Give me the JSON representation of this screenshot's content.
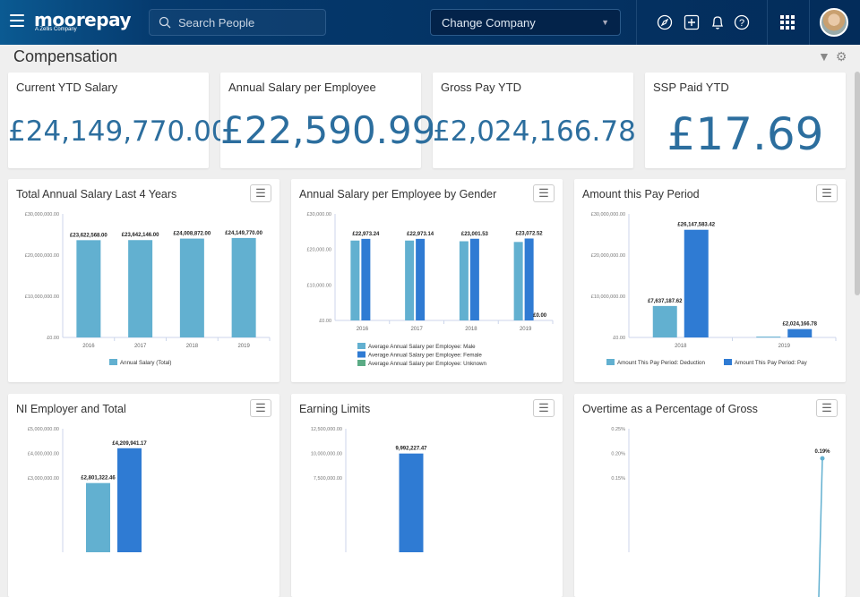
{
  "header": {
    "logo": "moorepay",
    "logo_sub": "A Zellis Company",
    "search_placeholder": "Search People",
    "company_select": "Change Company",
    "icons": [
      "menu-icon",
      "search-icon",
      "compass-icon",
      "add-icon",
      "bell-icon",
      "help-icon",
      "apps-grid-icon",
      "avatar"
    ]
  },
  "page": {
    "title": "Compensation"
  },
  "kpis": [
    {
      "label": "Current YTD Salary",
      "value": "£24,149,770.00"
    },
    {
      "label": "Annual Salary per Employee",
      "value": "£22,590.99"
    },
    {
      "label": "Gross Pay YTD",
      "value": "£2,024,166.78"
    },
    {
      "label": "SSP Paid YTD",
      "value": "£17.69"
    }
  ],
  "colors": {
    "light": "#62b0d0",
    "dark": "#2f7bd3",
    "green": "#5bab85",
    "kpi": "#2c6e9e"
  },
  "chart_data": [
    {
      "type": "bar",
      "title": "Total Annual Salary Last 4 Years",
      "ylim": [
        0,
        30000000
      ],
      "yticks": [
        "£0.00",
        "£10,000,000.00",
        "£20,000,000.00",
        "£30,000,000.00"
      ],
      "ytick_values": [
        0,
        10000000,
        20000000,
        30000000
      ],
      "categories": [
        "2016",
        "2017",
        "2018",
        "2019"
      ],
      "series": [
        {
          "name": "Annual Salary (Total)",
          "color": "#62b0d0",
          "values": [
            23622568,
            23642146,
            24008872,
            24149770
          ],
          "labels": [
            "£23,622,568.00",
            "£23,642,146.00",
            "£24,008,872.00",
            "£24,149,770.00"
          ]
        }
      ]
    },
    {
      "type": "bar",
      "title": "Annual Salary per Employee by Gender",
      "ylim": [
        0,
        30000
      ],
      "yticks": [
        "£0.00",
        "£10,000.00",
        "£20,000.00",
        "£30,000.00"
      ],
      "ytick_values": [
        0,
        10000,
        20000,
        30000
      ],
      "categories": [
        "2016",
        "2017",
        "2018",
        "2019"
      ],
      "series": [
        {
          "name": "Average Annual Salary per Employee: Male",
          "color": "#62b0d0",
          "values": [
            22500,
            22500,
            22300,
            22100
          ],
          "labels": [
            "",
            "",
            "",
            ""
          ]
        },
        {
          "name": "Average Annual Salary per Employee: Female",
          "color": "#2f7bd3",
          "values": [
            22973.24,
            22973.14,
            23001.53,
            23072.52
          ],
          "labels": [
            "£22,973.24",
            "£22,973.14",
            "£23,001.53",
            "£23,072.52"
          ]
        },
        {
          "name": "Average Annual Salary per Employee: Unknown",
          "color": "#5bab85",
          "values": [
            null,
            null,
            null,
            0
          ],
          "labels": [
            "",
            "",
            "",
            "£0.00"
          ]
        }
      ]
    },
    {
      "type": "bar",
      "title": "Amount this Pay Period",
      "ylim": [
        0,
        30000000
      ],
      "yticks": [
        "£0.00",
        "£10,000,000.00",
        "£20,000,000.00",
        "£30,000,000.00"
      ],
      "ytick_values": [
        0,
        10000000,
        20000000,
        30000000
      ],
      "categories": [
        "2018",
        "2019"
      ],
      "series": [
        {
          "name": "Amount This Pay Period: Deduction",
          "color": "#62b0d0",
          "values": [
            7637187.62,
            200000
          ],
          "labels": [
            "£7,637,187.62",
            ""
          ]
        },
        {
          "name": "Amount This Pay Period: Pay",
          "color": "#2f7bd3",
          "values": [
            26147583.42,
            2024166.78
          ],
          "labels": [
            "£26,147,583.42",
            "£2,024,166.78"
          ]
        }
      ]
    },
    {
      "type": "bar",
      "title": "NI Employer and Total",
      "ylim": [
        0,
        5000000
      ],
      "yticks": [
        "£3,000,000.00",
        "£4,000,000.00",
        "£5,000,000.00"
      ],
      "ytick_values": [
        3000000,
        4000000,
        5000000
      ],
      "categories": [
        ""
      ],
      "series": [
        {
          "color": "#62b0d0",
          "values": [
            2801322.46
          ],
          "labels": [
            "£2,801,322.46"
          ]
        },
        {
          "color": "#2f7bd3",
          "values": [
            4209941.17
          ],
          "labels": [
            "£4,209,941.17"
          ]
        }
      ]
    },
    {
      "type": "bar",
      "title": "Earning Limits",
      "ylim": [
        0,
        12500000
      ],
      "yticks": [
        "7,500,000.00",
        "10,000,000.00",
        "12,500,000.00"
      ],
      "ytick_values": [
        7500000,
        10000000,
        12500000
      ],
      "categories": [
        ""
      ],
      "series": [
        {
          "color": "#2f7bd3",
          "values": [
            9992227.47
          ],
          "labels": [
            "9,992,227.47"
          ]
        }
      ]
    },
    {
      "type": "line",
      "title": "Overtime as a Percentage of Gross",
      "ylim": [
        0,
        0.25
      ],
      "yticks": [
        "0.15%",
        "0.20%",
        "0.25%"
      ],
      "ytick_values": [
        0.15,
        0.2,
        0.25
      ],
      "categories": [
        ""
      ],
      "series": [
        {
          "color": "#62b0d0",
          "values": [
            0.19
          ],
          "labels": [
            "0.19%"
          ]
        }
      ]
    }
  ]
}
